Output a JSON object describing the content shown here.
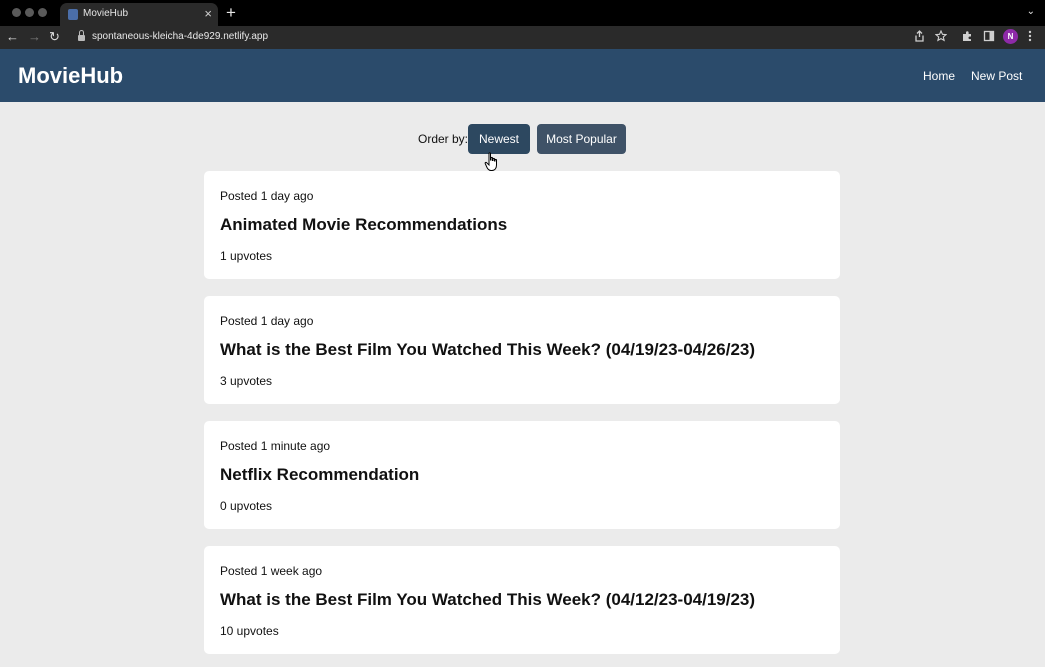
{
  "browser": {
    "tab_title": "MovieHub",
    "tab_close": "×",
    "new_tab": "+",
    "tab_menu": "⌄",
    "url": "spontaneous-kleicha-4de929.netlify.app",
    "back": "←",
    "forward": "→",
    "reload": "↻",
    "profile_initial": "N",
    "icons": [
      "share-icon",
      "star-icon",
      "extensions-icon",
      "sidepanel-icon",
      "kebab-menu-icon"
    ]
  },
  "header": {
    "brand": "MovieHub",
    "nav": [
      {
        "label": "Home"
      },
      {
        "label": "New Post"
      }
    ]
  },
  "order": {
    "label": "Order by:",
    "buttons": [
      {
        "label": "Newest"
      },
      {
        "label": "Most Popular"
      }
    ]
  },
  "posts": [
    {
      "posted": "Posted 1 day ago",
      "title": "Animated Movie Recommendations",
      "upvotes": "1 upvotes"
    },
    {
      "posted": "Posted 1 day ago",
      "title": "What is the Best Film You Watched This Week? (04/19/23-04/26/23)",
      "upvotes": "3 upvotes"
    },
    {
      "posted": "Posted 1 minute ago",
      "title": "Netflix Recommendation",
      "upvotes": "0 upvotes"
    },
    {
      "posted": "Posted 1 week ago",
      "title": "What is the Best Film You Watched This Week? (04/12/23-04/19/23)",
      "upvotes": "10 upvotes"
    }
  ],
  "colors": {
    "header_bg": "#2b4b6b",
    "button_bg": "#2d4860",
    "page_bg": "#ebebeb",
    "card_bg": "#ffffff"
  }
}
